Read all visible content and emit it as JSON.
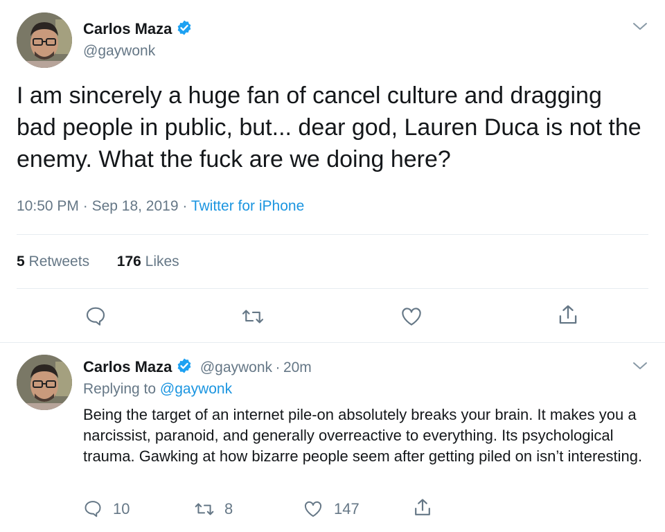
{
  "tweet": {
    "author_name": "Carlos Maza",
    "author_handle": "@gaywonk",
    "text": "I am sincerely a huge fan of cancel culture and dragging bad people in public, but... dear god, Lauren Duca is not the enemy. What the fuck are we doing here?",
    "time": "10:50 PM",
    "date": "Sep 18, 2019",
    "source": "Twitter for iPhone",
    "sep": "·",
    "retweets_count": "5",
    "retweets_label": "Retweets",
    "likes_count": "176",
    "likes_label": "Likes",
    "actions": {
      "reply_icon": "reply-icon",
      "retweet_icon": "retweet-icon",
      "like_icon": "heart-icon",
      "share_icon": "share-icon"
    }
  },
  "reply": {
    "author_name": "Carlos Maza",
    "author_handle": "@gaywonk",
    "time_ago": "20m",
    "sep": "·",
    "replying_prefix": "Replying to",
    "replying_handle": "@gaywonk",
    "text": "Being the target of an internet pile-on absolutely breaks your brain. It makes you a narcissist, paranoid, and generally overreactive to everything. Its psychological trauma. Gawking at how bizarre people seem after getting piled on isn’t interesting.",
    "reply_count": "10",
    "retweet_count": "8",
    "like_count": "147"
  },
  "colors": {
    "link": "#1b95e0",
    "muted": "#657786",
    "text": "#14171a",
    "divider": "#e6ecf0"
  }
}
